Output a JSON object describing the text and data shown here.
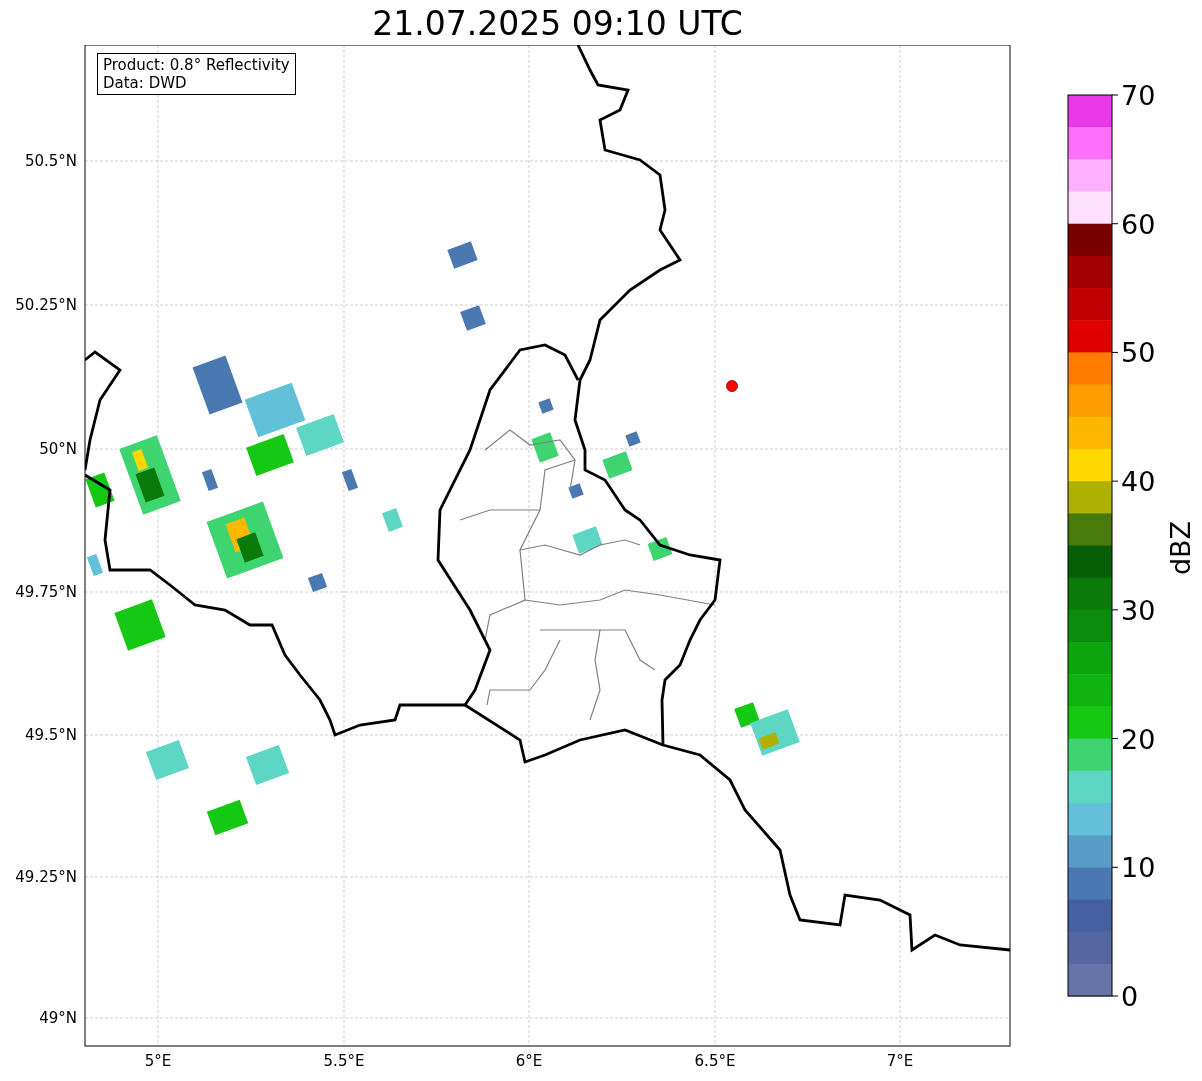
{
  "title": "21.07.2025 09:10 UTC",
  "info_box": {
    "lines": [
      "Product: 0.8° Reflectivity",
      "Data: DWD"
    ]
  },
  "map": {
    "x_ticks": [
      "5°E",
      "5.5°E",
      "6°E",
      "6.5°E",
      "7°E"
    ],
    "y_ticks": [
      "50.5°N",
      "50.25°N",
      "50°N",
      "49.75°N",
      "49.5°N",
      "49.25°N",
      "49°N"
    ]
  },
  "colorbar": {
    "label": "dBZ",
    "ticks": [
      "70",
      "60",
      "50",
      "40",
      "30",
      "20",
      "10",
      "0"
    ],
    "bins": [
      {
        "color": "#e838e8"
      },
      {
        "color": "#ff70ff"
      },
      {
        "color": "#ffb0ff"
      },
      {
        "color": "#ffe0ff"
      },
      {
        "color": "#7a0000"
      },
      {
        "color": "#a00000"
      },
      {
        "color": "#c00000"
      },
      {
        "color": "#e00000"
      },
      {
        "color": "#ff7c00"
      },
      {
        "color": "#ff9c00"
      },
      {
        "color": "#ffb800"
      },
      {
        "color": "#ffd800"
      },
      {
        "color": "#b0b000"
      },
      {
        "color": "#4a7a0a"
      },
      {
        "color": "#075e07"
      },
      {
        "color": "#0a7a0a"
      },
      {
        "color": "#0c8c0c"
      },
      {
        "color": "#0ea40e"
      },
      {
        "color": "#10b410"
      },
      {
        "color": "#14c814"
      },
      {
        "color": "#3ed470"
      },
      {
        "color": "#5ed6c4"
      },
      {
        "color": "#62c0d8"
      },
      {
        "color": "#5a9cc8"
      },
      {
        "color": "#4a78b0"
      },
      {
        "color": "#4560a0"
      },
      {
        "color": "#5567a0"
      },
      {
        "color": "#6675a8"
      }
    ]
  }
}
